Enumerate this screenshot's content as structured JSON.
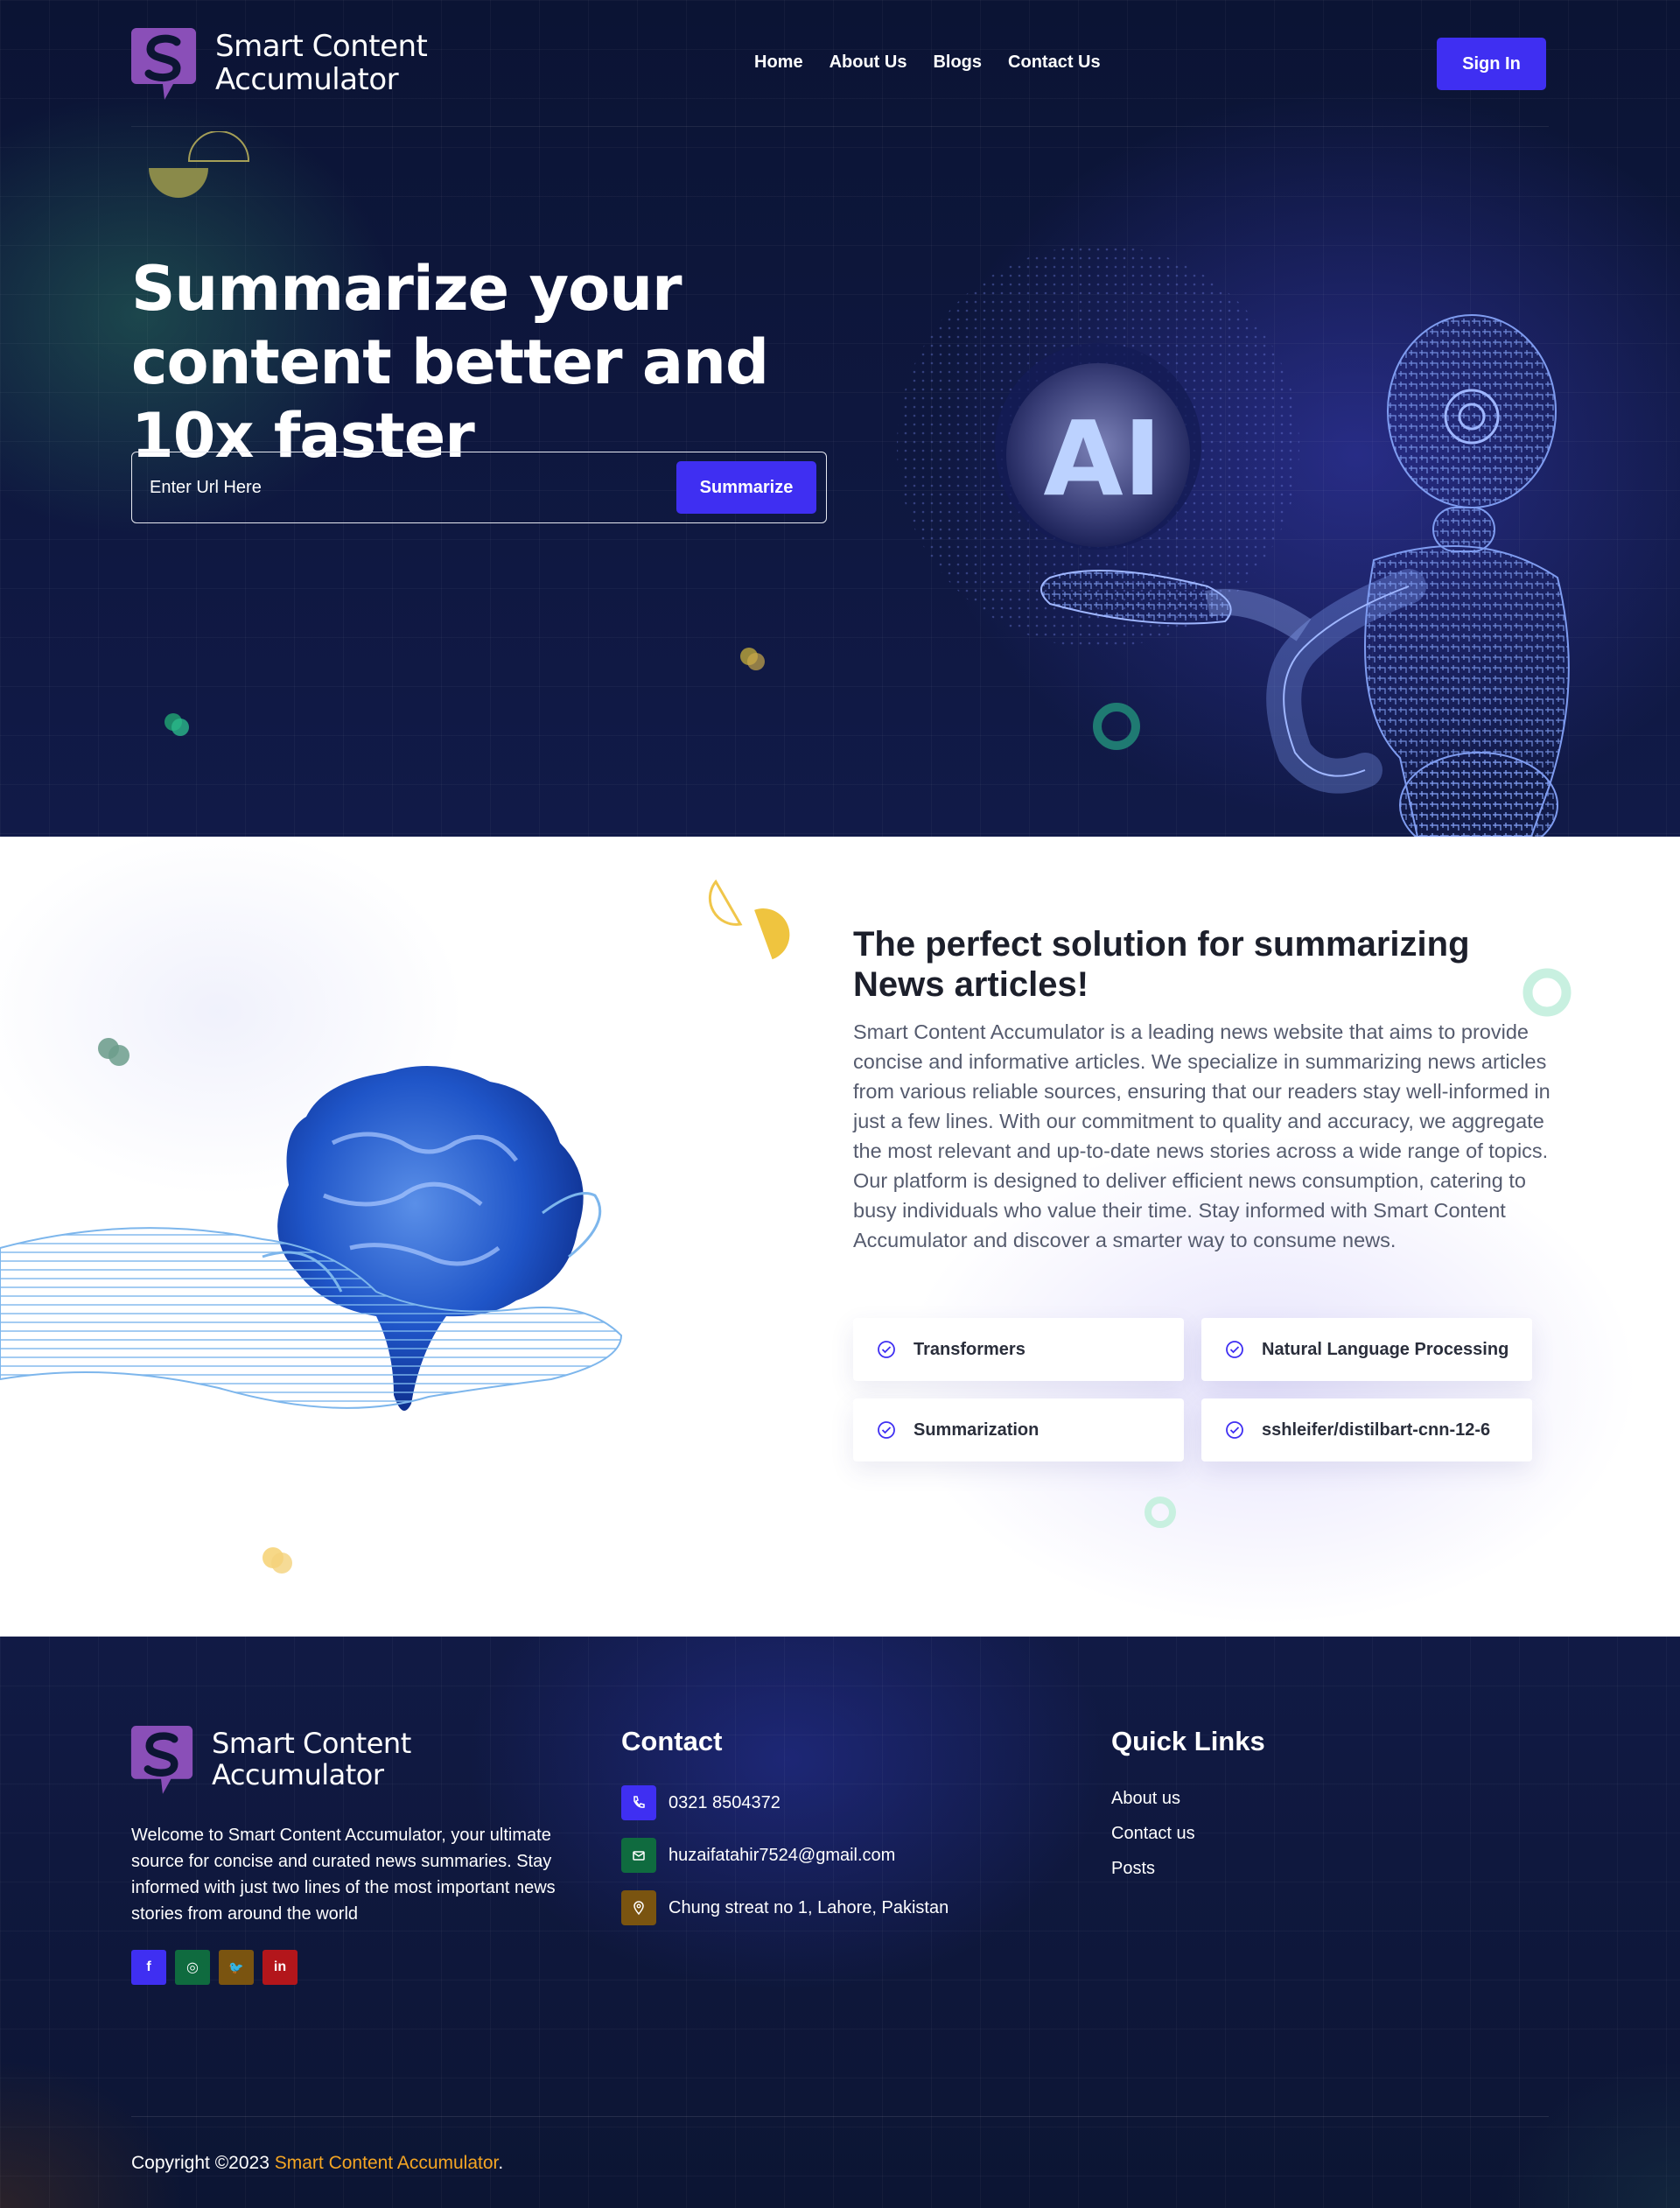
{
  "brand": {
    "name_line1": "Smart Content",
    "name_line2": "Accumulator"
  },
  "nav": {
    "items": [
      "Home",
      "About Us",
      "Blogs",
      "Contact Us"
    ],
    "signin_label": "Sign In"
  },
  "hero": {
    "title": "Summarize your content better and 10x faster",
    "url_placeholder": "Enter Url Here",
    "summarize_label": "Summarize",
    "illustration_text": "AI"
  },
  "about": {
    "title": "The perfect solution for summarizing News articles!",
    "body": "Smart Content Accumulator is a leading news website that aims to provide concise and informative articles. We specialize in summarizing news articles from various reliable sources, ensuring that our readers stay well-informed in just a few lines. With our commitment to quality and accuracy, we aggregate the most relevant and up-to-date news stories across a wide range of topics. Our platform is designed to deliver efficient news consumption, catering to busy individuals who value their time. Stay informed with Smart Content Accumulator and discover a smarter way to consume news.",
    "tags": [
      "Transformers",
      "Natural Language Processing",
      "Summarization",
      "sshleifer/distilbart-cnn-12-6"
    ]
  },
  "footer": {
    "description": "Welcome to Smart Content Accumulator, your ultimate source for concise and curated news summaries. Stay informed with just two lines of the most important news stories from around the world",
    "socials": [
      {
        "icon": "facebook-icon",
        "glyph": "f",
        "color": "#3f2ff2"
      },
      {
        "icon": "instagram-icon",
        "glyph": "◎",
        "color": "#0f6b3f"
      },
      {
        "icon": "twitter-icon",
        "glyph": "🐦",
        "color": "#7a5410"
      },
      {
        "icon": "linkedin-icon",
        "glyph": "in",
        "color": "#b3161b"
      }
    ],
    "contact_title": "Contact",
    "phone": "0321 8504372",
    "email": "huzaifatahir7524@gmail.com",
    "address": "Chung streat no 1, Lahore, Pakistan",
    "quick_links_title": "Quick Links",
    "quick_links": [
      "About us",
      "Contact us",
      "Posts"
    ],
    "copyright_prefix": "Copyright ©2023",
    "copyright_brand": "Smart Content Accumulator",
    "copyright_suffix": "."
  },
  "colors": {
    "accent": "#3f2ff2",
    "footer_brand": "#f5a623",
    "logo": "#8a4fb8"
  }
}
